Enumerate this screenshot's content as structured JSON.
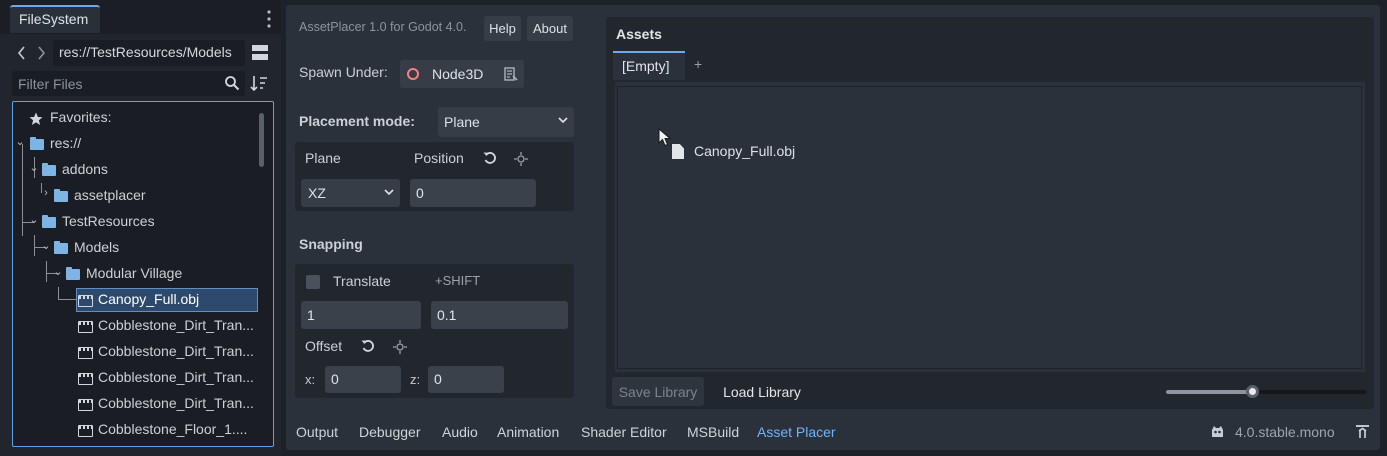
{
  "filesystem": {
    "tab_label": "FileSystem",
    "path": "res://TestResources/Models",
    "filter_placeholder": "Filter Files",
    "tree": [
      {
        "label": "Favorites:",
        "icon": "star-icon"
      },
      {
        "label": "res://",
        "icon": "folder-icon"
      },
      {
        "label": "addons",
        "icon": "folder-icon"
      },
      {
        "label": "assetplacer",
        "icon": "folder-icon"
      },
      {
        "label": "TestResources",
        "icon": "folder-icon"
      },
      {
        "label": "Models",
        "icon": "folder-icon"
      },
      {
        "label": "Modular Village",
        "icon": "folder-icon"
      },
      {
        "label": "Canopy_Full.obj",
        "icon": "scene-icon",
        "selected": true
      },
      {
        "label": "Cobblestone_Dirt_Tran...",
        "icon": "scene-icon"
      },
      {
        "label": "Cobblestone_Dirt_Tran...",
        "icon": "scene-icon"
      },
      {
        "label": "Cobblestone_Dirt_Tran...",
        "icon": "scene-icon"
      },
      {
        "label": "Cobblestone_Dirt_Tran...",
        "icon": "scene-icon"
      },
      {
        "label": "Cobblestone_Floor_1....",
        "icon": "scene-icon"
      }
    ]
  },
  "assetplacer": {
    "version": "AssetPlacer 1.0 for Godot 4.0.",
    "help_label": "Help",
    "about_label": "About",
    "spawn_under_label": "Spawn Under:",
    "spawn_node": "Node3D",
    "placement_mode_label": "Placement mode:",
    "placement_mode_value": "Plane",
    "plane_label": "Plane",
    "position_label": "Position",
    "plane_value": "XZ",
    "position_value": "0",
    "snapping_label": "Snapping",
    "translate_label": "Translate",
    "translate_checked": false,
    "shift_hint": "+SHIFT",
    "snap_step": "1",
    "snap_shift_step": "0.1",
    "offset_label": "Offset",
    "offset_x_label": "x:",
    "offset_x": "0",
    "offset_z_label": "z:",
    "offset_z": "0"
  },
  "assets": {
    "title": "Assets",
    "tabs": [
      "[Empty]",
      "+"
    ],
    "items": [
      "Canopy_Full.obj"
    ],
    "save_library_label": "Save Library",
    "load_library_label": "Load Library",
    "zoom_level": 0.43
  },
  "bottom_tabs": [
    "Output",
    "Debugger",
    "Audio",
    "Animation",
    "Shader Editor",
    "MSBuild",
    "Asset Placer"
  ],
  "active_bottom_tab": "Asset Placer",
  "engine_version": "4.0.stable.mono",
  "colors": {
    "accent": "#6fb3ff",
    "selection": "#2d4a6d",
    "node_color": "#fc7f7f",
    "folder": "#7eb3e6"
  }
}
